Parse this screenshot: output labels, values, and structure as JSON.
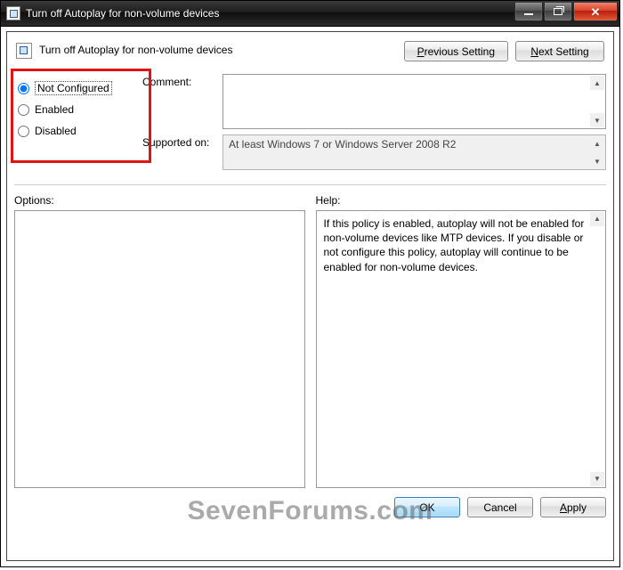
{
  "window": {
    "title": "Turn off Autoplay for non-volume devices"
  },
  "header": {
    "policy_name": "Turn off Autoplay for non-volume devices",
    "prev_button": "Previous Setting",
    "next_button": "Next Setting",
    "prev_key": "P",
    "next_key": "N"
  },
  "state": {
    "radios": {
      "not_configured": "Not Configured",
      "enabled": "Enabled",
      "disabled": "Disabled",
      "selected": "not_configured"
    },
    "comment_label": "Comment:",
    "comment_value": "",
    "supported_label": "Supported on:",
    "supported_value": "At least Windows 7 or Windows Server 2008 R2"
  },
  "lower": {
    "options_label": "Options:",
    "help_label": "Help:",
    "help_text": "If this policy is enabled, autoplay will not be enabled for non-volume devices like MTP devices. If you disable or not configure this policy, autoplay will continue to be enabled for non-volume devices."
  },
  "buttons": {
    "ok": "OK",
    "cancel": "Cancel",
    "apply": "Apply"
  },
  "watermark": "SevenForums.com"
}
